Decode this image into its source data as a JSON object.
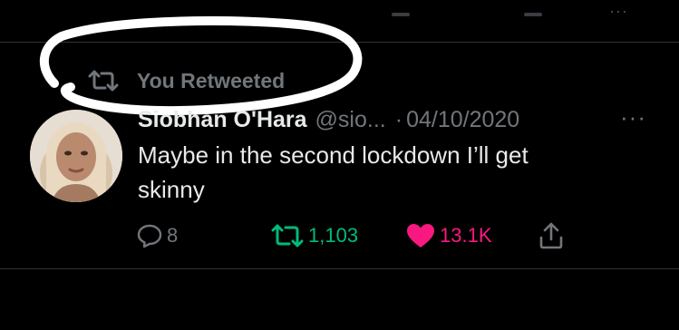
{
  "retweet_header": {
    "label": "You Retweeted"
  },
  "tweet": {
    "author_name": "Siobhan O'Hara",
    "author_handle": "@sio...",
    "separator": "·",
    "date": "04/10/2020",
    "text": "Maybe in the second lockdown I’ll get\nskinny",
    "more_glyph": "···",
    "prev_more_glyph": "···"
  },
  "actions": {
    "reply_count": "8",
    "retweet_count": "1,103",
    "like_count": "13.1K"
  },
  "icons": {
    "retweet": "retweet-icon",
    "reply": "reply-icon",
    "like": "heart-icon",
    "share": "share-icon"
  },
  "colors": {
    "background": "#000000",
    "text_primary": "#e7e9ea",
    "text_secondary": "#71767b",
    "retweet_active": "#00ba7c",
    "like_active": "#f91880",
    "divider": "#2f3336",
    "annotation": "#ffffff"
  }
}
